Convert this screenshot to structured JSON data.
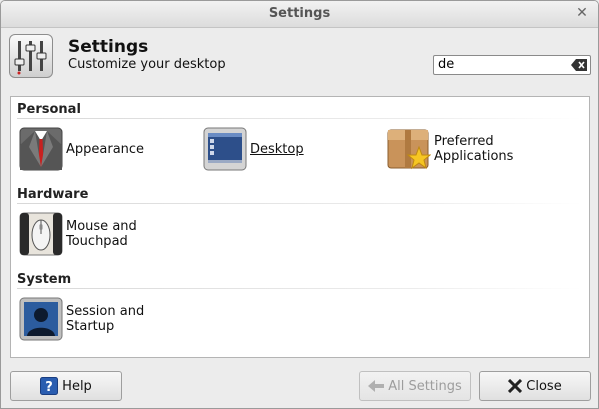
{
  "window": {
    "title": "Settings"
  },
  "header": {
    "title": "Settings",
    "subtitle": "Customize your desktop"
  },
  "search": {
    "value": "de",
    "placeholder": ""
  },
  "categories": [
    {
      "name": "Personal",
      "items": [
        {
          "label_lines": [
            "Appearance"
          ],
          "icon": "appearance-icon"
        },
        {
          "label_lines": [
            "Desktop"
          ],
          "icon": "desktop-icon",
          "highlighted": true
        },
        {
          "label_lines": [
            "Preferred",
            "Applications"
          ],
          "icon": "preferred-applications-icon"
        }
      ]
    },
    {
      "name": "Hardware",
      "items": [
        {
          "label_lines": [
            "Mouse and",
            "Touchpad"
          ],
          "icon": "mouse-icon"
        }
      ]
    },
    {
      "name": "System",
      "items": [
        {
          "label_lines": [
            "Session and",
            "Startup"
          ],
          "icon": "session-icon"
        }
      ]
    }
  ],
  "buttons": {
    "help": "Help",
    "all_settings": "All Settings",
    "close": "Close"
  },
  "colors": {
    "help_blue": "#2a5db0",
    "session_blue": "#2c5c9e"
  }
}
